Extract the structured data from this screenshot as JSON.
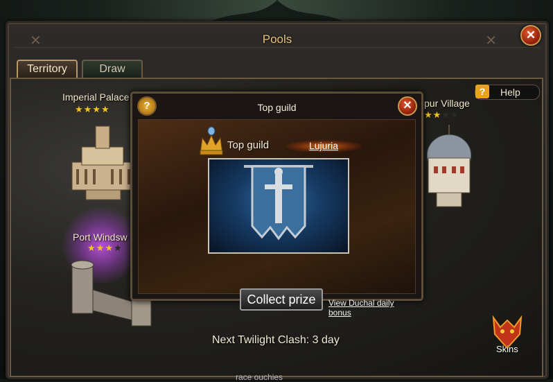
{
  "window": {
    "title": "Pools",
    "close_label": "✕"
  },
  "tabs": [
    {
      "label": "Territory",
      "active": true
    },
    {
      "label": "Draw",
      "active": false
    }
  ],
  "help": {
    "icon": "?",
    "label": "Help"
  },
  "locations": [
    {
      "name": "Imperial Palace",
      "stars": 4,
      "max_stars": 4
    },
    {
      "name": "Port Windsw",
      "stars": 3,
      "max_stars": 4
    },
    {
      "name": "pur Village",
      "stars": 2,
      "max_stars": 4
    }
  ],
  "modal": {
    "title": "Top guild",
    "help_icon": "?",
    "close_label": "✕",
    "top_guild_label": "Top guild",
    "guild_name": "Lujuria",
    "collect_button": "Collect prize",
    "ducal_link": "View Duchal daily bonus"
  },
  "footer": {
    "clash_label": "Next Twilight Clash:",
    "clash_value": "3",
    "clash_unit": "day",
    "skins_label": "Skins",
    "bottom_text": "race ouchies"
  },
  "colors": {
    "title_gold": "#e6c27a",
    "star_gold": "#f4c322",
    "close_red": "#c2401c",
    "help_orange": "#e9a21f",
    "banner_blue": "#2c6aa0"
  }
}
